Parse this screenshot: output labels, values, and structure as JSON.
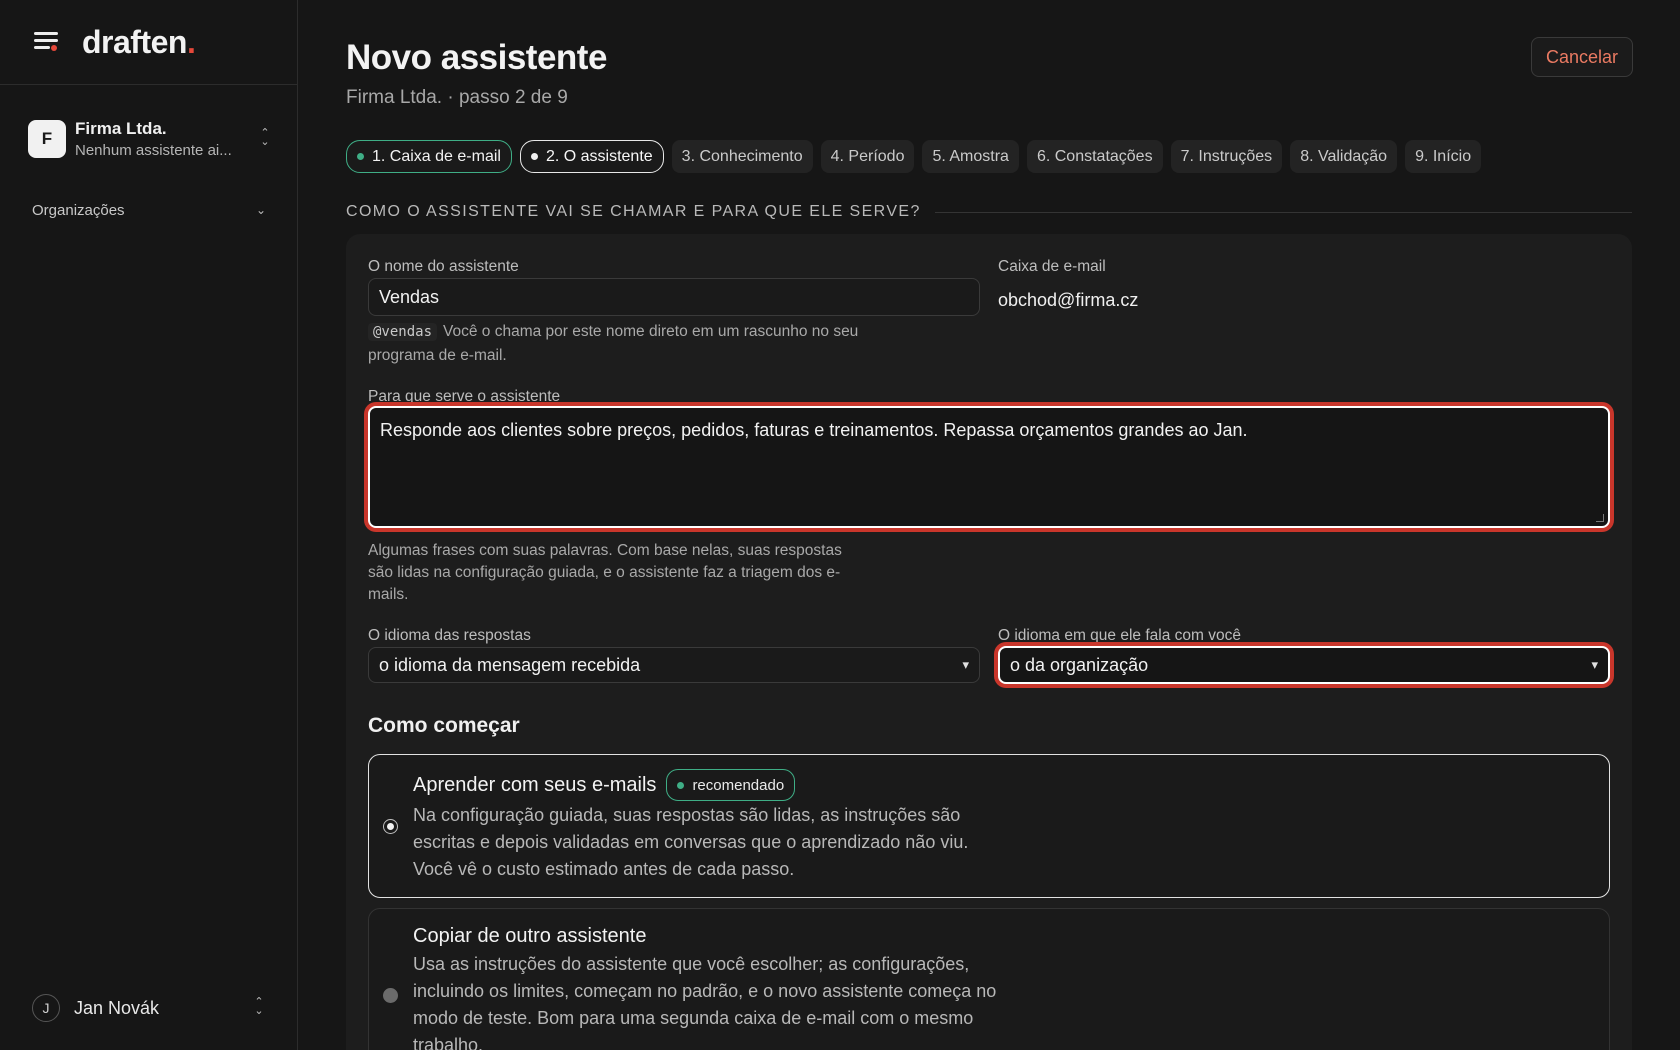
{
  "brand": {
    "logo_text": "draften",
    "logo_dot": "."
  },
  "sidebar": {
    "org": {
      "avatar": "F",
      "name": "Firma Ltda.",
      "subtitle": "Nenhum assistente ai..."
    },
    "nav_organizations": "Organizações",
    "user": {
      "avatar": "J",
      "name": "Jan Novák"
    }
  },
  "header": {
    "title": "Novo assistente",
    "subtitle": "Firma Ltda. · passo 2 de 9",
    "cancel_label": "Cancelar"
  },
  "steps": [
    {
      "label": "1. Caixa de e-mail",
      "state": "done"
    },
    {
      "label": "2. O assistente",
      "state": "current"
    },
    {
      "label": "3. Conhecimento",
      "state": "pending"
    },
    {
      "label": "4. Período",
      "state": "pending"
    },
    {
      "label": "5. Amostra",
      "state": "pending"
    },
    {
      "label": "6. Constatações",
      "state": "pending"
    },
    {
      "label": "7. Instruções",
      "state": "pending"
    },
    {
      "label": "8. Validação",
      "state": "pending"
    },
    {
      "label": "9. Início",
      "state": "pending"
    }
  ],
  "section_title": "COMO O ASSISTENTE VAI SE CHAMAR E PARA QUE ELE SERVE?",
  "form": {
    "name_label": "O nome do assistente",
    "name_value": "Vendas",
    "handle": "@vendas",
    "name_help": "Você o chama por este nome direto em um rascunho no seu programa de e-mail.",
    "mailbox_label": "Caixa de e-mail",
    "mailbox_value": "obchod@firma.cz",
    "purpose_label": "Para que serve o assistente",
    "purpose_value": "Responde aos clientes sobre preços, pedidos, faturas e treinamentos. Repassa orçamentos grandes ao Jan.",
    "purpose_help": "Algumas frases com suas palavras. Com base nelas, suas respostas são lidas na configuração guiada, e o assistente faz a triagem dos e-mails.",
    "reply_lang_label": "O idioma das respostas",
    "reply_lang_value": "o idioma da mensagem recebida",
    "talk_lang_label": "O idioma em que ele fala com você",
    "talk_lang_value": "o da organização"
  },
  "start": {
    "heading": "Como começar",
    "options": [
      {
        "title": "Aprender com seus e-mails",
        "badge": "recomendado",
        "selected": true,
        "description": "Na configuração guiada, suas respostas são lidas, as instruções são escritas e depois validadas em conversas que o aprendizado não viu. Você vê o custo estimado antes de cada passo."
      },
      {
        "title": "Copiar de outro assistente",
        "selected": false,
        "description": "Usa as instruções do assistente que você escolher; as configurações, incluindo os limites, começam no padrão, e o novo assistente começa no modo de teste. Bom para uma segunda caixa de e-mail com o mesmo trabalho."
      }
    ]
  },
  "colors": {
    "accent_green": "#3fae86",
    "focus_red": "#c9362b",
    "cancel": "#ea7a62",
    "logo_dot": "#e5483a"
  }
}
